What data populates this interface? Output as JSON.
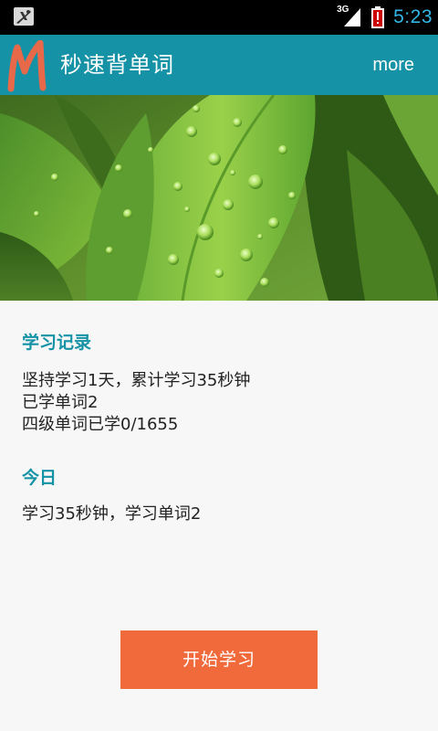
{
  "status_bar": {
    "network_label": "3G",
    "time": "5:23",
    "colors": {
      "time": "#33b5e5",
      "battery_warning": "#cc0000"
    }
  },
  "action_bar": {
    "logo_letter": "M",
    "title": "秒速背单词",
    "more_label": "more",
    "background_color": "#1592a6"
  },
  "banner": {
    "image_description_icon": "leaf-with-water-drops"
  },
  "record": {
    "title": "学习记录",
    "lines": [
      "坚持学习1天，累计学习35秒钟",
      "已学单词2",
      "四级单词已学0/1655"
    ]
  },
  "today": {
    "title": "今日",
    "line": "学习35秒钟，学习单词2"
  },
  "start_button": {
    "label": "开始学习",
    "color": "#f06a3c"
  }
}
